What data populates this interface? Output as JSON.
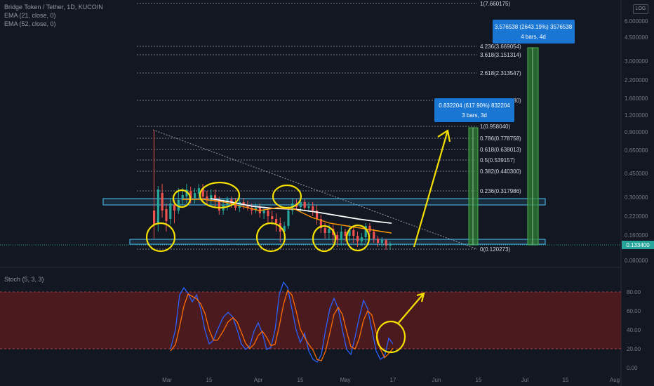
{
  "header": {
    "symbol_line": "Bridge Token / Tether, 1D, KUCOIN",
    "ema1": "EMA (21, close, 0)",
    "ema2": "EMA (52, close, 0)",
    "log_button": "LOG"
  },
  "stoch": {
    "label": "Stoch (5, 3, 3)"
  },
  "price_axis": [
    "6.000000",
    "4.500000",
    "3.000000",
    "2.200000",
    "1.600000",
    "1.200000",
    "0.900000",
    "0.650000",
    "0.450000",
    "0.300000",
    "0.220000",
    "0.160000",
    "0.080000"
  ],
  "current_price": "0.133400",
  "stoch_axis": [
    "80.00",
    "60.00",
    "40.00",
    "20.00",
    "0.00"
  ],
  "time_axis": [
    "Mar",
    "15",
    "Apr",
    "15",
    "May",
    "17",
    "Jun",
    "15",
    "Jul",
    "15",
    "Aug"
  ],
  "fib_levels": [
    {
      "label": "1(7.660175)"
    },
    {
      "label": "4.236(3.669054)"
    },
    {
      "label": "3.618(3.151314)"
    },
    {
      "label": "2.618(2.313547)"
    },
    {
      "label": "1.618(1.475780)"
    },
    {
      "label": "1(0.958040)"
    },
    {
      "label": "0.786(0.778758)"
    },
    {
      "label": "0.618(0.638013)"
    },
    {
      "label": "0.5(0.539157)"
    },
    {
      "label": "0.382(0.440300)"
    },
    {
      "label": "0.236(0.317986)"
    },
    {
      "label": "0(0.120273)"
    }
  ],
  "measure_boxes": [
    {
      "line1": "0.832204 (617.90%) 832204",
      "line2": "3 bars, 3d"
    },
    {
      "line1": "3.576538 (2643.19%) 3576538",
      "line2": "4 bars, 4d"
    }
  ],
  "colors": {
    "background": "#131722",
    "zone": "#4fc3f7",
    "annotation": "#f5e000",
    "bull": "#26a69a",
    "bear": "#ef5350",
    "ema_fast": "#ff9800",
    "ema_slow": "#ffffff",
    "stoch_k": "#2962ff",
    "stoch_d": "#ff6d00",
    "stoch_band": "#5b1616",
    "measure_box": "#1976d2",
    "measure_bar": "#2e7d32"
  }
}
